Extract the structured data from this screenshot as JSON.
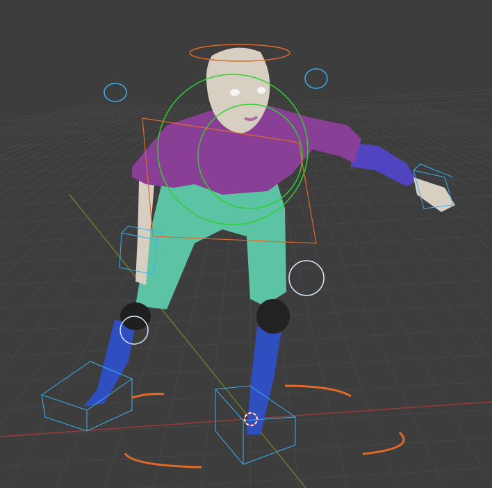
{
  "viewport": {
    "type": "3d-viewport",
    "colors": {
      "background": "#3d3d3d",
      "grid": "#484848",
      "x_axis": "#9a3a3a",
      "y_axis": "#6b7a2a",
      "skin": "#d6cfc2",
      "shirt": "#8a3f96",
      "pants": "#5cc4a4",
      "socks": "#2f4fc0",
      "knee_pads": "#222222",
      "sleeve": "#5044c0",
      "bone_orange": "#e06a2a",
      "bone_green": "#2ed02e",
      "bone_blue": "#3ab0f0",
      "bone_white": "#d8ecff"
    },
    "icons": [
      "3d-cursor-icon"
    ]
  }
}
